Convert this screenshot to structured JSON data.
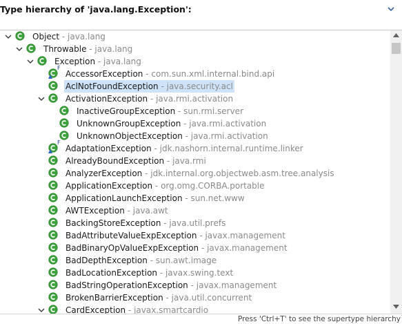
{
  "header": {
    "title": "Type hierarchy of 'java.lang.Exception':"
  },
  "status": {
    "hint": "Press 'Ctrl+T' to see the supertype hierarchy"
  },
  "colors": {
    "class_icon": "#3ba33b",
    "selection": "#cfe3f8",
    "package_text": "#8a8a8a"
  },
  "tree": {
    "rows": [
      {
        "name": "Object",
        "pkg": " - java.lang",
        "twisty": "expanded",
        "icon": "class-icon",
        "badge": "",
        "selected": false
      },
      {
        "name": "Throwable",
        "pkg": " - java.lang",
        "twisty": "expanded",
        "icon": "class-icon",
        "badge": "",
        "selected": false
      },
      {
        "name": "Exception",
        "pkg": " - java.lang",
        "twisty": "expanded",
        "icon": "class-icon",
        "badge": "",
        "selected": false
      },
      {
        "name": "AccessorException",
        "pkg": " - com.sun.xml.internal.bind.api",
        "twisty": "none",
        "icon": "class-icon",
        "badge": "F",
        "selected": false
      },
      {
        "name": "AclNotFoundException",
        "pkg": " - java.security.acl",
        "twisty": "none",
        "icon": "class-icon",
        "badge": "",
        "selected": true
      },
      {
        "name": "ActivationException",
        "pkg": " - java.rmi.activation",
        "twisty": "expanded",
        "icon": "class-icon",
        "badge": "",
        "selected": false
      },
      {
        "name": "InactiveGroupException",
        "pkg": " - sun.rmi.server",
        "twisty": "none",
        "icon": "class-icon",
        "badge": "",
        "selected": false
      },
      {
        "name": "UnknownGroupException",
        "pkg": " - java.rmi.activation",
        "twisty": "none",
        "icon": "class-icon",
        "badge": "",
        "selected": false
      },
      {
        "name": "UnknownObjectException",
        "pkg": " - java.rmi.activation",
        "twisty": "none",
        "icon": "class-icon",
        "badge": "",
        "selected": false
      },
      {
        "name": "AdaptationException",
        "pkg": " - jdk.nashorn.internal.runtime.linker",
        "twisty": "none",
        "icon": "class-icon",
        "badge": "F",
        "selected": false
      },
      {
        "name": "AlreadyBoundException",
        "pkg": " - java.rmi",
        "twisty": "none",
        "icon": "class-icon",
        "badge": "",
        "selected": false
      },
      {
        "name": "AnalyzerException",
        "pkg": " - jdk.internal.org.objectweb.asm.tree.analysis",
        "twisty": "none",
        "icon": "class-icon",
        "badge": "",
        "selected": false
      },
      {
        "name": "ApplicationException",
        "pkg": " - org.omg.CORBA.portable",
        "twisty": "none",
        "icon": "class-icon",
        "badge": "",
        "selected": false
      },
      {
        "name": "ApplicationLaunchException",
        "pkg": " - sun.net.www",
        "twisty": "none",
        "icon": "class-icon",
        "badge": "",
        "selected": false
      },
      {
        "name": "AWTException",
        "pkg": " - java.awt",
        "twisty": "none",
        "icon": "class-icon",
        "badge": "",
        "selected": false
      },
      {
        "name": "BackingStoreException",
        "pkg": " - java.util.prefs",
        "twisty": "none",
        "icon": "class-icon",
        "badge": "",
        "selected": false
      },
      {
        "name": "BadAttributeValueExpException",
        "pkg": " - javax.management",
        "twisty": "none",
        "icon": "class-icon",
        "badge": "",
        "selected": false
      },
      {
        "name": "BadBinaryOpValueExpException",
        "pkg": " - javax.management",
        "twisty": "none",
        "icon": "class-icon",
        "badge": "",
        "selected": false
      },
      {
        "name": "BadDepthException",
        "pkg": " - sun.awt.image",
        "twisty": "none",
        "icon": "class-icon",
        "badge": "",
        "selected": false
      },
      {
        "name": "BadLocationException",
        "pkg": " - javax.swing.text",
        "twisty": "none",
        "icon": "class-icon",
        "badge": "",
        "selected": false
      },
      {
        "name": "BadStringOperationException",
        "pkg": " - javax.management",
        "twisty": "none",
        "icon": "class-icon",
        "badge": "",
        "selected": false
      },
      {
        "name": "BrokenBarrierException",
        "pkg": " - java.util.concurrent",
        "twisty": "none",
        "icon": "class-icon",
        "badge": "",
        "selected": false
      },
      {
        "name": "CardException",
        "pkg": " - javax.smartcardio",
        "twisty": "expanded",
        "icon": "class-icon",
        "badge": "",
        "selected": false
      }
    ]
  }
}
